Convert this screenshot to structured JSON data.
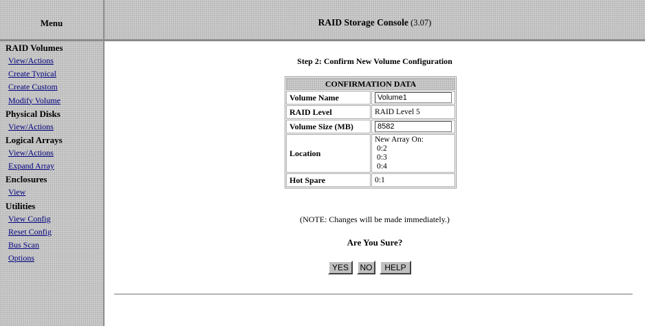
{
  "sidebar": {
    "title": "Menu",
    "sections": [
      {
        "label": "RAID Volumes",
        "links": [
          "View/Actions",
          "Create Typical",
          "Create Custom",
          "Modify Volume"
        ]
      },
      {
        "label": "Physical Disks",
        "links": [
          "View/Actions"
        ]
      },
      {
        "label": "Logical Arrays",
        "links": [
          "View/Actions",
          "Expand Array"
        ]
      },
      {
        "label": "Enclosures",
        "links": [
          "View"
        ]
      },
      {
        "label": "Utilities",
        "links": [
          "View Config",
          "Reset Config",
          "Bus Scan",
          "Options"
        ]
      }
    ]
  },
  "header": {
    "title": "RAID Storage Console",
    "version": "(3.07)"
  },
  "main": {
    "step_title": "Step 2: Confirm New Volume Configuration",
    "table": {
      "heading": "CONFIRMATION DATA",
      "volume_name_label": "Volume Name",
      "volume_name_value": "Volume1",
      "raid_level_label": "RAID Level",
      "raid_level_value": "RAID Level 5",
      "volume_size_label": "Volume Size (MB)",
      "volume_size_value": "8582",
      "location_label": "Location",
      "location_lines": [
        "New Array On:",
        "0:2",
        "0:3",
        "0:4"
      ],
      "hot_spare_label": "Hot Spare",
      "hot_spare_value": "0:1"
    },
    "note": "(NOTE: Changes will be made immediately.)",
    "confirm_question": "Are You Sure?",
    "buttons": {
      "yes": "YES",
      "no": "NO",
      "help": "HELP"
    }
  },
  "colors": {
    "link": "#00007f",
    "panel_bg": "#c4c4c4",
    "border": "#8a8a8a"
  }
}
